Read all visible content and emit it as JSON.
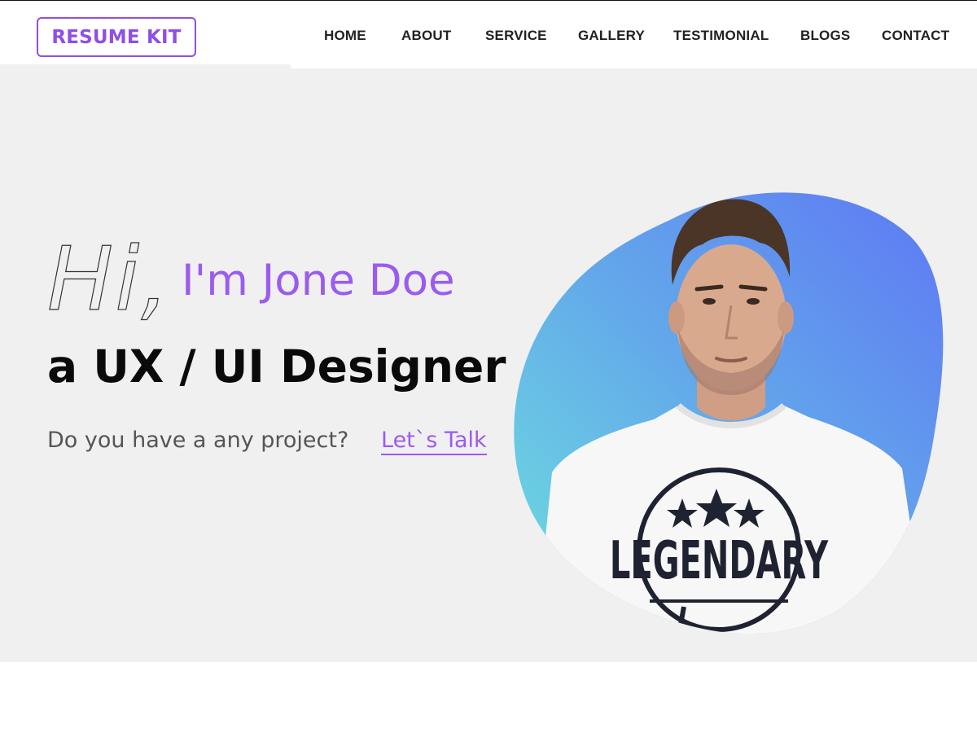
{
  "header": {
    "logo": "RESUME KIT",
    "nav": [
      "HOME",
      "ABOUT",
      "SERVICE",
      "GALLERY",
      "TESTIMONIAL",
      "BLOGS",
      "CONTACT"
    ]
  },
  "hero": {
    "greeting": "Hi,",
    "name": "I'm Jone Doe",
    "role": "a UX / UI Designer",
    "question": "Do you have a any project?",
    "cta": "Let`s Talk"
  },
  "portrait": {
    "shirt_text": "LEGENDARY"
  },
  "colors": {
    "accent": "#9b5bf0",
    "hero_bg": "#f0f0f0",
    "blob_start": "#6ee0df",
    "blob_end": "#5e77f4",
    "text_dark": "#0a0a0a",
    "text_muted": "#555555"
  }
}
